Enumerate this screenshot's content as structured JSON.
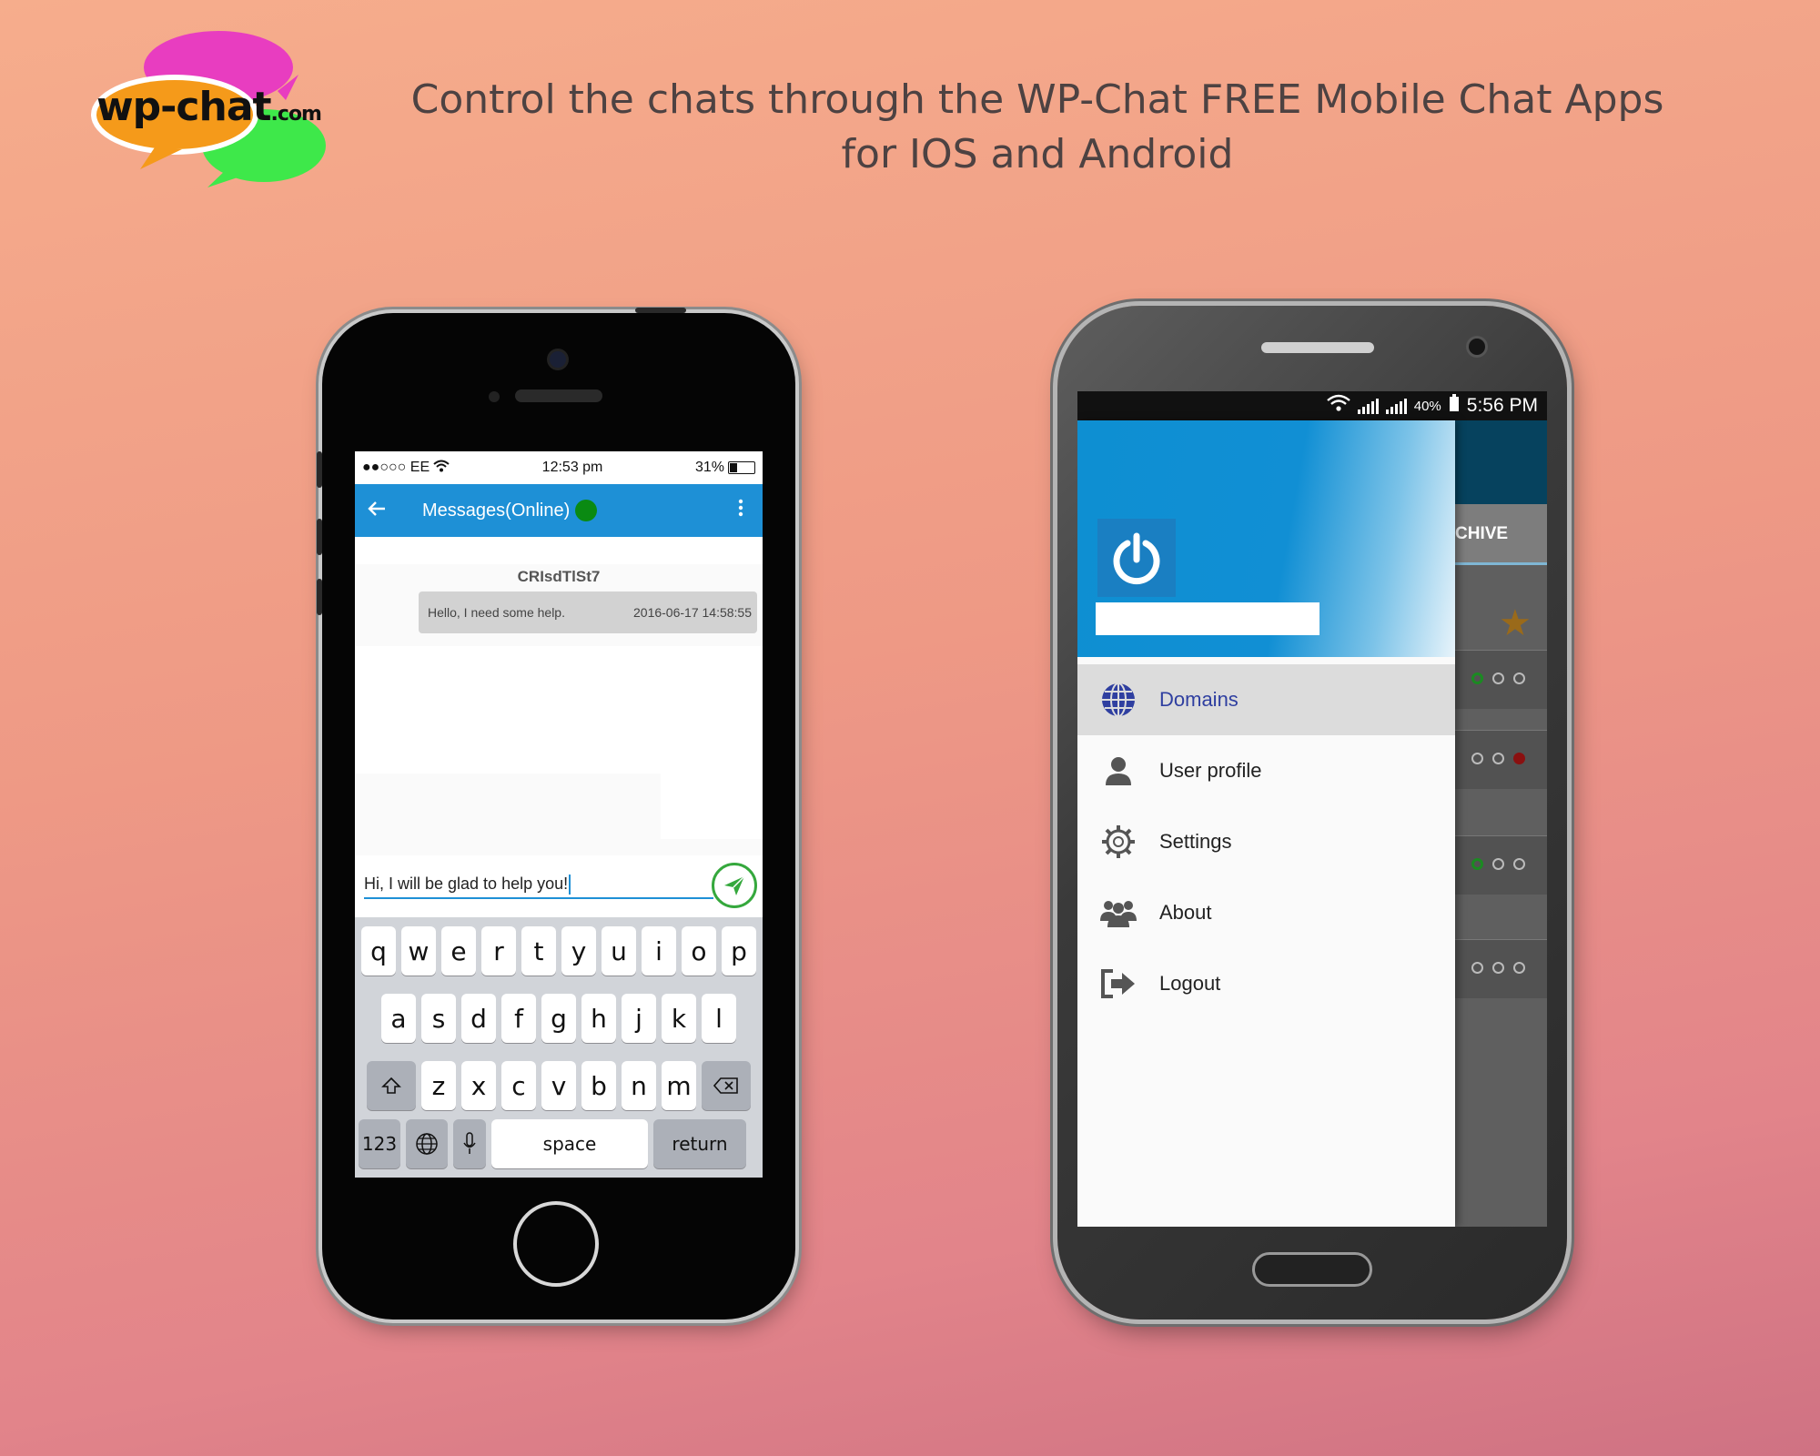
{
  "logo": {
    "main": "wp-chat",
    "suffix": ".com"
  },
  "headline": {
    "line1": "Control the chats through the WP-Chat FREE Mobile Chat Apps",
    "line2": "for IOS and Android"
  },
  "colors": {
    "ios_accent": "#1e90d6",
    "online": "#0a8a12",
    "send_green": "#35a83d",
    "drawer_active_text": "#2f3fa0",
    "android_appbar": "#06425e"
  },
  "ios": {
    "status": {
      "carrier": "●●○○○ EE",
      "time": "12:53 pm",
      "battery": "31%"
    },
    "appbar": {
      "back_icon": "arrow-left-icon",
      "title": "Messages(Online)",
      "menu_icon": "more-vert-icon"
    },
    "chat": {
      "visitor": "CRIsdTlSt7",
      "message": {
        "text": "Hello, I need some help.",
        "timestamp": "2016-06-17 14:58:55"
      }
    },
    "compose": {
      "value": "Hi, I will be glad to help you!"
    },
    "keyboard": {
      "row1": [
        "q",
        "w",
        "e",
        "r",
        "t",
        "y",
        "u",
        "i",
        "o",
        "p"
      ],
      "row2": [
        "a",
        "s",
        "d",
        "f",
        "g",
        "h",
        "j",
        "k",
        "l"
      ],
      "row3": [
        "z",
        "x",
        "c",
        "v",
        "b",
        "n",
        "m"
      ],
      "numbers": "123",
      "space": "space",
      "return": "return"
    }
  },
  "android": {
    "status": {
      "battery": "40%",
      "time": "5:56 PM"
    },
    "background_app": {
      "tab_fragment": "CHIVE"
    },
    "drawer": {
      "items": [
        {
          "label": "Domains",
          "icon": "globe-icon",
          "active": true
        },
        {
          "label": "User profile",
          "icon": "user-icon",
          "active": false
        },
        {
          "label": "Settings",
          "icon": "gear-icon",
          "active": false
        },
        {
          "label": "About",
          "icon": "group-icon",
          "active": false
        },
        {
          "label": "Logout",
          "icon": "logout-icon",
          "active": false
        }
      ]
    }
  }
}
